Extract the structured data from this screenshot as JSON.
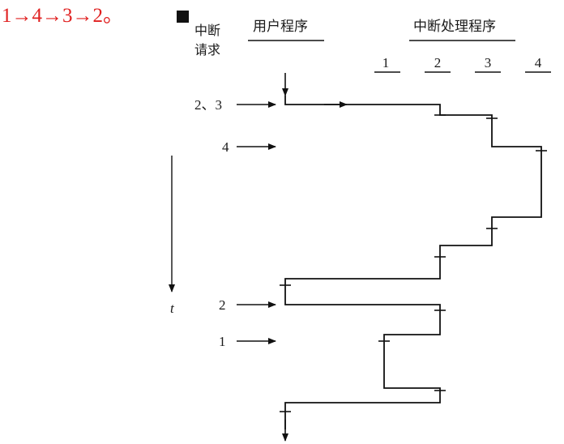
{
  "answer": "1→4→3→2。",
  "header": {
    "interrupt_request_line1": "中断",
    "interrupt_request_line2": "请求",
    "user_program": "用户程序",
    "interrupt_handler": "中断处理程序",
    "levels": [
      "1",
      "2",
      "3",
      "4"
    ]
  },
  "time_label": "t",
  "requests": [
    {
      "label": "2、3"
    },
    {
      "label": "4"
    },
    {
      "label": "2"
    },
    {
      "label": "1"
    }
  ],
  "colors": {
    "answer": "#e02020",
    "line": "#111111"
  }
}
